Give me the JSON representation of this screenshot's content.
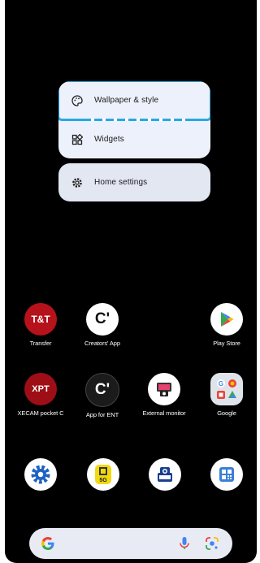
{
  "menu": {
    "items": [
      {
        "label": "Wallpaper & style",
        "icon": "palette-icon"
      },
      {
        "label": "Widgets",
        "icon": "widgets-icon"
      }
    ],
    "home_settings": {
      "label": "Home settings",
      "icon": "settings-gear-icon"
    }
  },
  "apps": {
    "row1": [
      {
        "label": "Transfer",
        "icon": "transfer-app-icon",
        "badge": "T&T"
      },
      {
        "label": "Creators' App",
        "icon": "creators-app-icon",
        "badge": "C'"
      },
      {
        "label": "Play Store",
        "icon": "play-store-icon"
      }
    ],
    "row2": [
      {
        "label": "XECAM pocket C",
        "icon": "xecam-app-icon",
        "badge": "XPT"
      },
      {
        "label": "App for ENT",
        "icon": "app-for-ent-icon",
        "badge": "C'"
      },
      {
        "label": "External monitor",
        "icon": "external-monitor-icon"
      },
      {
        "label": "Google",
        "icon": "google-folder-icon"
      }
    ]
  },
  "dock": [
    {
      "icon": "settings-app-icon"
    },
    {
      "icon": "5g-app-icon",
      "badge": "5G"
    },
    {
      "icon": "camera-app-icon"
    },
    {
      "icon": "qr-scanner-icon"
    }
  ],
  "search_bar": {
    "icons": [
      "google-g-icon",
      "microphone-icon",
      "google-lens-icon"
    ]
  },
  "colors": {
    "background": "#000000",
    "menu": "#edf1fb",
    "highlight": "#27a9e1"
  }
}
